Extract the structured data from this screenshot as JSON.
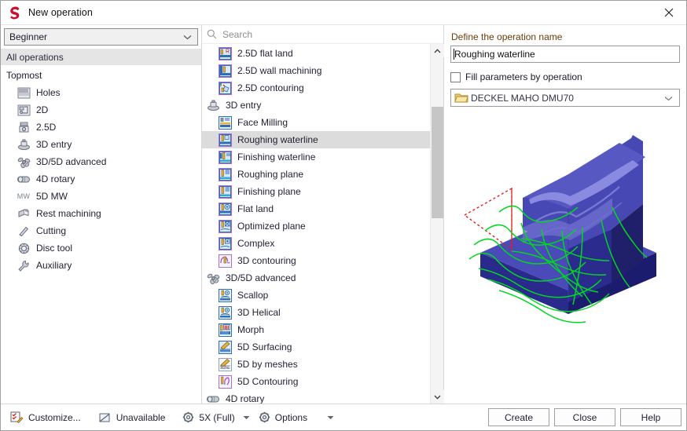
{
  "window": {
    "title": "New operation",
    "logo_icon": "sprut-s-logo-icon",
    "close_icon": "close-icon"
  },
  "sidebar": {
    "level_select": {
      "value": "Beginner",
      "chevron_icon": "chevron-down-icon"
    },
    "all_operations_label": "All operations",
    "root_label": "Topmost",
    "items": [
      {
        "label": "Holes",
        "icon": "holes-icon"
      },
      {
        "label": "2D",
        "icon": "2d-icon"
      },
      {
        "label": "2.5D",
        "icon": "2-5d-icon"
      },
      {
        "label": "3D entry",
        "icon": "3d-entry-icon"
      },
      {
        "label": "3D/5D advanced",
        "icon": "3d-5d-advanced-icon"
      },
      {
        "label": "4D rotary",
        "icon": "4d-rotary-icon"
      },
      {
        "label": "5D MW",
        "icon": "5d-mw-icon"
      },
      {
        "label": "Rest machining",
        "icon": "rest-machining-icon"
      },
      {
        "label": "Cutting",
        "icon": "cutting-icon"
      },
      {
        "label": "Disc tool",
        "icon": "disc-tool-icon"
      },
      {
        "label": "Auxiliary",
        "icon": "auxiliary-icon"
      }
    ]
  },
  "operations": {
    "search": {
      "placeholder": "Search",
      "value": "",
      "icon": "search-icon"
    },
    "selected": "Roughing waterline",
    "rows": [
      {
        "type": "item",
        "label": "2.5D flat land",
        "icon": "milling-flat-land-icon"
      },
      {
        "type": "item",
        "label": "2.5D wall machining",
        "icon": "milling-wall-icon"
      },
      {
        "type": "item",
        "label": "2.5D contouring",
        "icon": "milling-contouring-icon"
      },
      {
        "type": "group",
        "label": "3D entry",
        "icon": "3d-entry-icon"
      },
      {
        "type": "item",
        "label": "Face Milling",
        "icon": "face-milling-icon"
      },
      {
        "type": "item",
        "label": "Roughing waterline",
        "icon": "roughing-waterline-icon"
      },
      {
        "type": "item",
        "label": "Finishing waterline",
        "icon": "finishing-waterline-icon"
      },
      {
        "type": "item",
        "label": "Roughing plane",
        "icon": "roughing-plane-icon"
      },
      {
        "type": "item",
        "label": "Finishing plane",
        "icon": "finishing-plane-icon"
      },
      {
        "type": "item",
        "label": "Flat land",
        "icon": "flat-land-icon"
      },
      {
        "type": "item",
        "label": "Optimized plane",
        "icon": "optimized-plane-icon"
      },
      {
        "type": "item",
        "label": "Complex",
        "icon": "complex-icon"
      },
      {
        "type": "item",
        "label": "3D contouring",
        "icon": "3d-contouring-icon"
      },
      {
        "type": "group",
        "label": "3D/5D advanced",
        "icon": "3d-5d-advanced-icon"
      },
      {
        "type": "item",
        "label": "Scallop",
        "icon": "scallop-icon"
      },
      {
        "type": "item",
        "label": "3D Helical",
        "icon": "3d-helical-icon"
      },
      {
        "type": "item",
        "label": "Morph",
        "icon": "morph-icon"
      },
      {
        "type": "item",
        "label": "5D Surfacing",
        "icon": "5d-surfacing-icon"
      },
      {
        "type": "item",
        "label": "5D by meshes",
        "icon": "5d-by-meshes-icon"
      },
      {
        "type": "item",
        "label": "5D Contouring",
        "icon": "5d-contouring-icon"
      },
      {
        "type": "group",
        "label": "4D rotary",
        "icon": "4d-rotary-icon"
      }
    ],
    "scrollbar": {
      "up_icon": "chevron-up-icon",
      "down_icon": "chevron-down-icon"
    }
  },
  "details": {
    "name_label": "Define the operation name",
    "name_value": "Roughing waterline",
    "fill_params_label": "Fill parameters by operation",
    "fill_params_checked": false,
    "machine_value": "DECKEL MAHO DMU70",
    "machine_folder_icon": "folder-icon",
    "machine_chevron_icon": "chevron-down-icon",
    "preview_alt": "3D toolpath preview of roughing waterline on blue part"
  },
  "footer": {
    "customize_label": "Customize...",
    "customize_icon": "customize-icon",
    "unavailable_label": "Unavailable",
    "unavailable_icon": "unavailable-icon",
    "axis_label": "5X (Full)",
    "axis_icon": "gear-icon",
    "axis_dropdown_icon": "dropdown-arrow-icon",
    "options_label": "Options",
    "options_icon": "gear-icon",
    "options_dropdown_icon": "dropdown-arrow-icon",
    "create_label": "Create",
    "close_label": "Close",
    "help_label": "Help"
  },
  "colors": {
    "accent": "#c8102e",
    "label_brown": "#6b3b08",
    "selection": "#dcdcdc",
    "part_blue": "#4040a8",
    "toolpath_green": "#00d820",
    "marker_red": "#e02020"
  }
}
